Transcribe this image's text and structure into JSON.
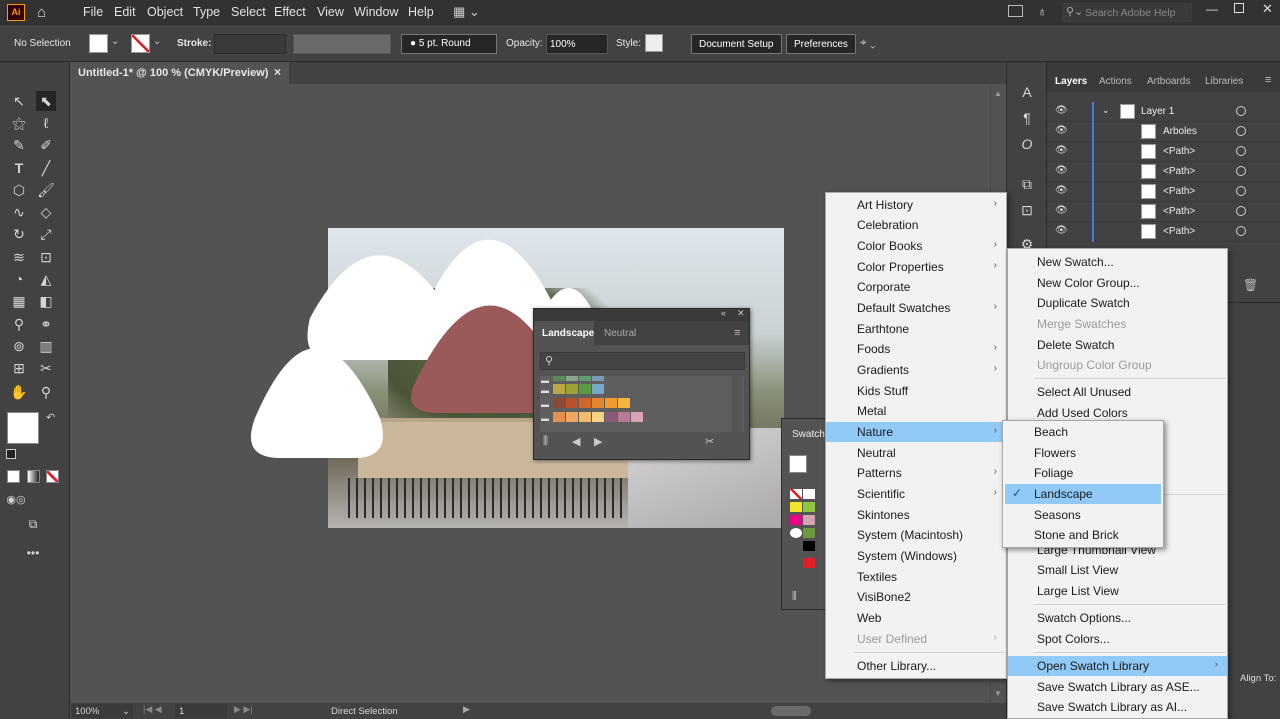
{
  "app": {
    "logo": "Ai"
  },
  "menubar": {
    "items": [
      "File",
      "Edit",
      "Object",
      "Type",
      "Select",
      "Effect",
      "View",
      "Window",
      "Help"
    ],
    "search_placeholder": "Search Adobe Help"
  },
  "control_bar": {
    "selection": "No Selection",
    "stroke_label": "Stroke:",
    "brush": "5 pt. Round",
    "opacity_label": "Opacity:",
    "opacity": "100%",
    "style_label": "Style:",
    "document_setup": "Document Setup",
    "preferences": "Preferences"
  },
  "document": {
    "tab_title": "Untitled-1* @ 100 % (CMYK/Preview)",
    "close": "×"
  },
  "status": {
    "zoom": "100%",
    "artboard": "1",
    "tool": "Direct Selection"
  },
  "layers": {
    "tabs": [
      "Layers",
      "Actions",
      "Artboards",
      "Libraries"
    ],
    "rows": [
      "Layer 1",
      "Arboles",
      "<Path>",
      "<Path>",
      "<Path>",
      "<Path>",
      "<Path>"
    ]
  },
  "library_panel": {
    "tabs": [
      "Landscape",
      "Neutral"
    ]
  },
  "swatch_panel": {
    "title": "Swatch"
  },
  "library_menu": {
    "items": [
      "Art History",
      "Celebration",
      "Color Books",
      "Color Properties",
      "Corporate",
      "Default Swatches",
      "Earthtone",
      "Foods",
      "Gradients",
      "Kids Stuff",
      "Metal",
      "Nature",
      "Neutral",
      "Patterns",
      "Scientific",
      "Skintones",
      "System (Macintosh)",
      "System (Windows)",
      "Textiles",
      "VisiBone2",
      "Web",
      "User Defined",
      "Other Library..."
    ],
    "submenu_flags": [
      true,
      false,
      true,
      true,
      false,
      true,
      false,
      true,
      true,
      false,
      false,
      true,
      false,
      true,
      true,
      false,
      false,
      false,
      false,
      false,
      false,
      true,
      false
    ],
    "highlighted": "Nature",
    "disabled": "User Defined"
  },
  "nature_menu": {
    "items": [
      "Beach",
      "Flowers",
      "Foliage",
      "Landscape",
      "Seasons",
      "Stone and Brick"
    ],
    "checked": "Landscape",
    "check_mark": "✓"
  },
  "swatches_menu": {
    "items": [
      "New Swatch...",
      "New Color Group...",
      "Duplicate Swatch",
      "Merge Swatches",
      "Delete Swatch",
      "Ungroup Color Group",
      "Select All Unused",
      "Add Used Colors",
      "Large Thumbnail View",
      "Small List View",
      "Large List View",
      "Swatch Options...",
      "Spot Colors...",
      "Open Swatch Library",
      "Save Swatch Library as ASE...",
      "Save Swatch Library as AI..."
    ],
    "disabled": [
      "Merge Swatches",
      "Ungroup Color Group"
    ],
    "highlighted": "Open Swatch Library"
  },
  "right_panel": {
    "label": "Align To:"
  },
  "colors": {
    "accent_blue": "#91c9f7",
    "mountain_red": "#9a5a5a",
    "layer_blue": "#4a7bd6"
  }
}
